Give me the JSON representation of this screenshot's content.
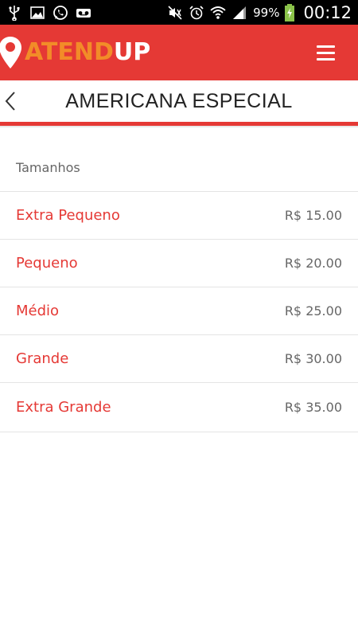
{
  "status_bar": {
    "icons_left": [
      "usb-icon",
      "image-icon",
      "whatsapp-icon",
      "voicemail-icon"
    ],
    "icons_right": [
      "mute-icon",
      "alarm-icon",
      "wifi-icon",
      "signal-icon",
      "battery-charging-icon"
    ],
    "battery": "99%",
    "time": "00:12"
  },
  "app_bar": {
    "logo_part1": "ATEND",
    "logo_part2": "UP",
    "brand_color": "#e53935",
    "logo_accent_color": "#f28c28",
    "menu_icon": "hamburger-menu-icon"
  },
  "title_bar": {
    "back_icon": "chevron-left-icon",
    "title": "AMERICANA ESPECIAL"
  },
  "sizes": {
    "label": "Tamanhos",
    "items": [
      {
        "name": "Extra Pequeno",
        "price": "R$ 15.00"
      },
      {
        "name": "Pequeno",
        "price": "R$ 20.00"
      },
      {
        "name": "Médio",
        "price": "R$ 25.00"
      },
      {
        "name": "Grande",
        "price": "R$ 30.00"
      },
      {
        "name": "Extra Grande",
        "price": "R$ 35.00"
      }
    ]
  }
}
